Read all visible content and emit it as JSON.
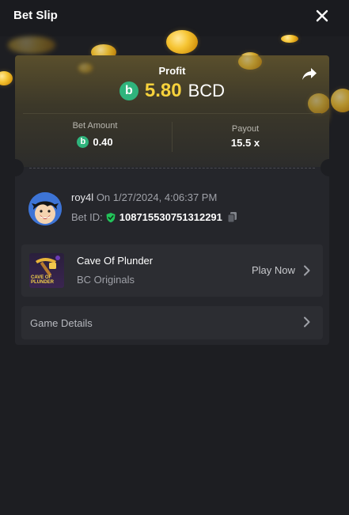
{
  "header": {
    "title": "Bet Slip"
  },
  "profit": {
    "label": "Profit",
    "value": "5.80",
    "currency": "BCD"
  },
  "stats": {
    "bet_amount_label": "Bet Amount",
    "bet_amount_value": "0.40",
    "payout_label": "Payout",
    "payout_value": "15.5 x"
  },
  "user": {
    "name": "roy4l",
    "time": "On 1/27/2024, 4:06:37 PM",
    "bet_id_label": "Bet ID:",
    "bet_id": "108715530751312291"
  },
  "game": {
    "name": "Cave Of Plunder",
    "provider": "BC Originals",
    "play_label": "Play Now",
    "thumb_text": "CAVE OF PLUNDER"
  },
  "details": {
    "label": "Game Details"
  },
  "colors": {
    "background": "#1d1e22",
    "card": "#25262b",
    "profit_value": "#f7d23c",
    "bc_green": "#2fb47c"
  },
  "icons": [
    "close-icon",
    "share-icon",
    "bc-coin-icon",
    "shield-check-icon",
    "copy-icon",
    "chevron-right-icon"
  ]
}
